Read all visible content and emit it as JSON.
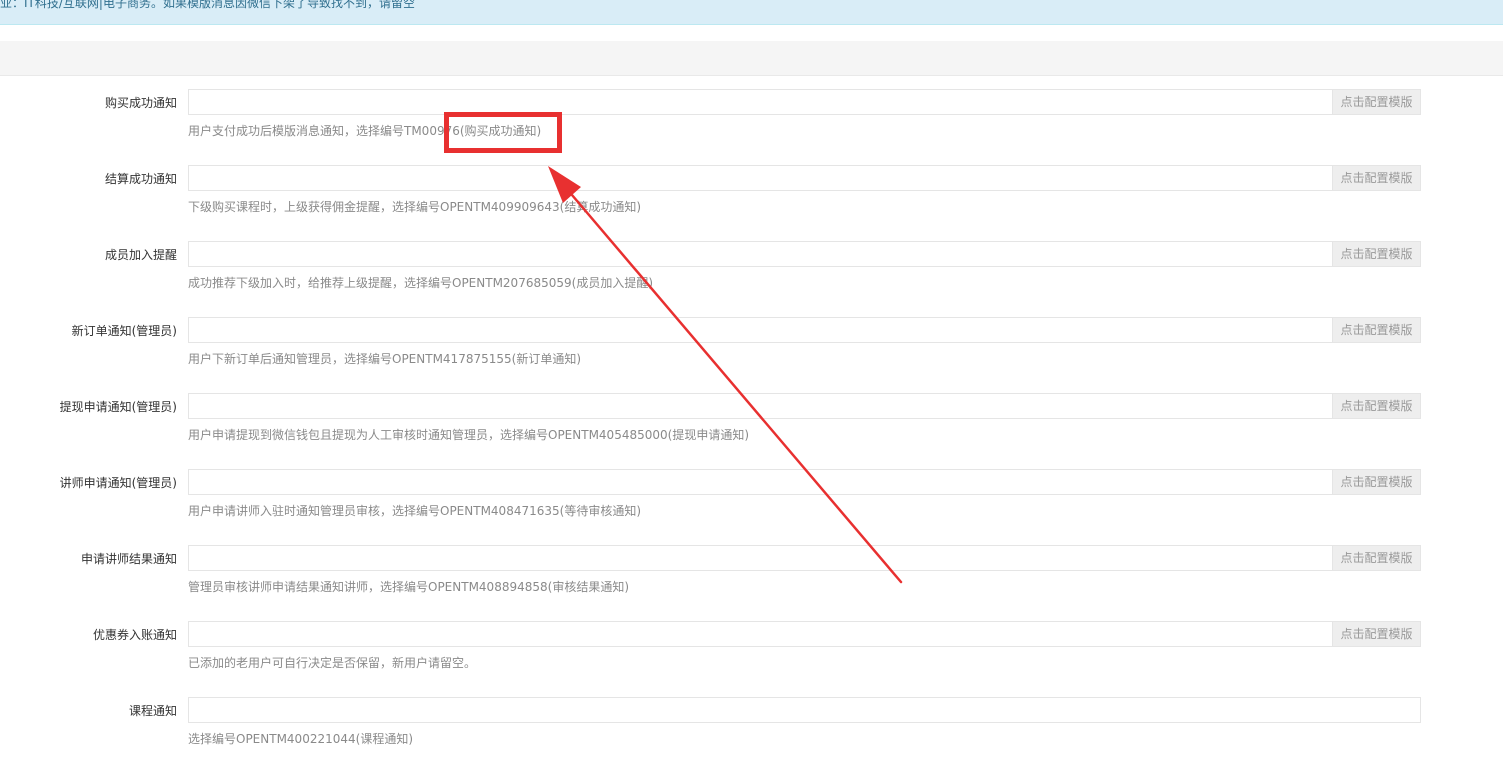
{
  "notice": {
    "text": "业：IT科技/互联网|电子商务。如果模版消息因微信下架了导致找不到，请留空"
  },
  "addon_label": "点击配置模版",
  "rows": [
    {
      "label": "购买成功通知",
      "value": "",
      "help": "用户支付成功后模版消息通知，选择编号TM00976(购买成功通知)"
    },
    {
      "label": "结算成功通知",
      "value": "",
      "help": "下级购买课程时，上级获得佣金提醒，选择编号OPENTM409909643(结算成功通知)"
    },
    {
      "label": "成员加入提醒",
      "value": "",
      "help": "成功推荐下级加入时，给推荐上级提醒，选择编号OPENTM207685059(成员加入提醒)"
    },
    {
      "label": "新订单通知(管理员)",
      "value": "",
      "help": "用户下新订单后通知管理员，选择编号OPENTM417875155(新订单通知)"
    },
    {
      "label": "提现申请通知(管理员)",
      "value": "",
      "help": "用户申请提现到微信钱包且提现为人工审核时通知管理员，选择编号OPENTM405485000(提现申请通知)"
    },
    {
      "label": "讲师申请通知(管理员)",
      "value": "",
      "help": "用户申请讲师入驻时通知管理员审核，选择编号OPENTM408471635(等待审核通知)"
    },
    {
      "label": "申请讲师结果通知",
      "value": "",
      "help": "管理员审核讲师申请结果通知讲师，选择编号OPENTM408894858(审核结果通知)"
    },
    {
      "label": "优惠券入账通知",
      "value": "",
      "help": "已添加的老用户可自行决定是否保留，新用户请留空。"
    },
    {
      "label": "课程通知",
      "value": "",
      "help": "选择编号OPENTM400221044(课程通知)"
    }
  ],
  "colors": {
    "annotation": "#e83030",
    "notice_background": "#d9edf7",
    "help_text": "#8a8a8a"
  }
}
